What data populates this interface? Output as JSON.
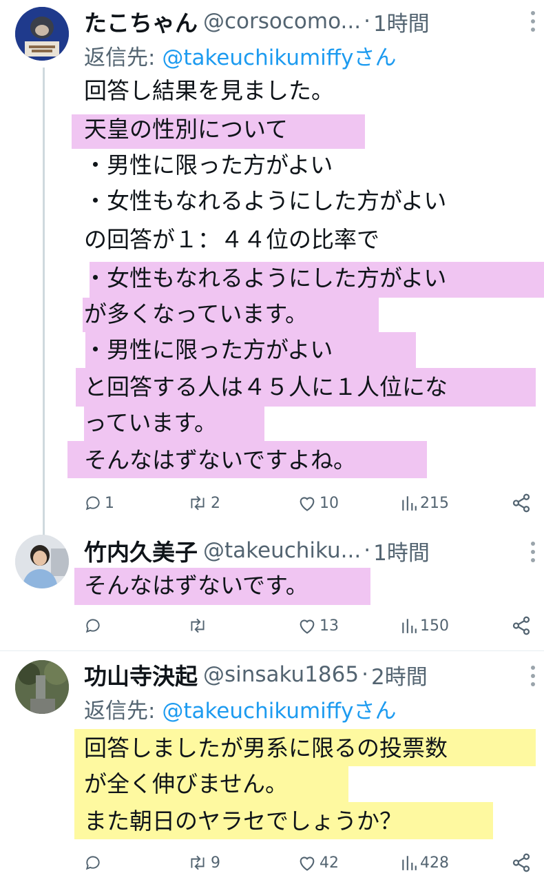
{
  "tweets": [
    {
      "name": "たこちゃん",
      "handle": "@corsocomo...",
      "dot": "·",
      "time": "1時間",
      "reply_prefix": "返信先: ",
      "reply_mention": "@takeuchikumiffyさん",
      "lines": [
        "回答し結果を見ました。",
        "天皇の性別について",
        "・男性に限った方がよい",
        "・女性もなれるようにした方がよい",
        "の回答が１：４４位の比率で",
        "・女性もなれるようにした方がよい",
        "が多くなっています。",
        "・男性に限った方がよい",
        "と回答する人は４５人に１人位にな",
        "っています。",
        "そんなはずないですよね。"
      ],
      "stats": {
        "replies": "1",
        "retweets": "2",
        "likes": "10",
        "views": "215"
      }
    },
    {
      "name": "竹内久美子",
      "handle": "@takeuchiku...",
      "dot": "·",
      "time": "1時間",
      "lines": [
        "そんなはずないです。"
      ],
      "stats": {
        "replies": "",
        "retweets": "",
        "likes": "13",
        "views": "150"
      }
    },
    {
      "name": "功山寺決起",
      "handle": "@sinsaku1865",
      "dot": "·",
      "time": "2時間",
      "reply_prefix": "返信先: ",
      "reply_mention": "@takeuchikumiffyさん",
      "lines": [
        "回答しましたが男系に限るの投票数",
        "が全く伸びません。",
        "また朝日のヤラセでしょうか？"
      ],
      "stats": {
        "replies": "",
        "retweets": "9",
        "likes": "42",
        "views": "428"
      }
    }
  ],
  "colors": {
    "mention": "#1d9bf0",
    "muted": "#536471",
    "pink_highlight": "#e496e8",
    "yellow_highlight": "#fdf678"
  }
}
